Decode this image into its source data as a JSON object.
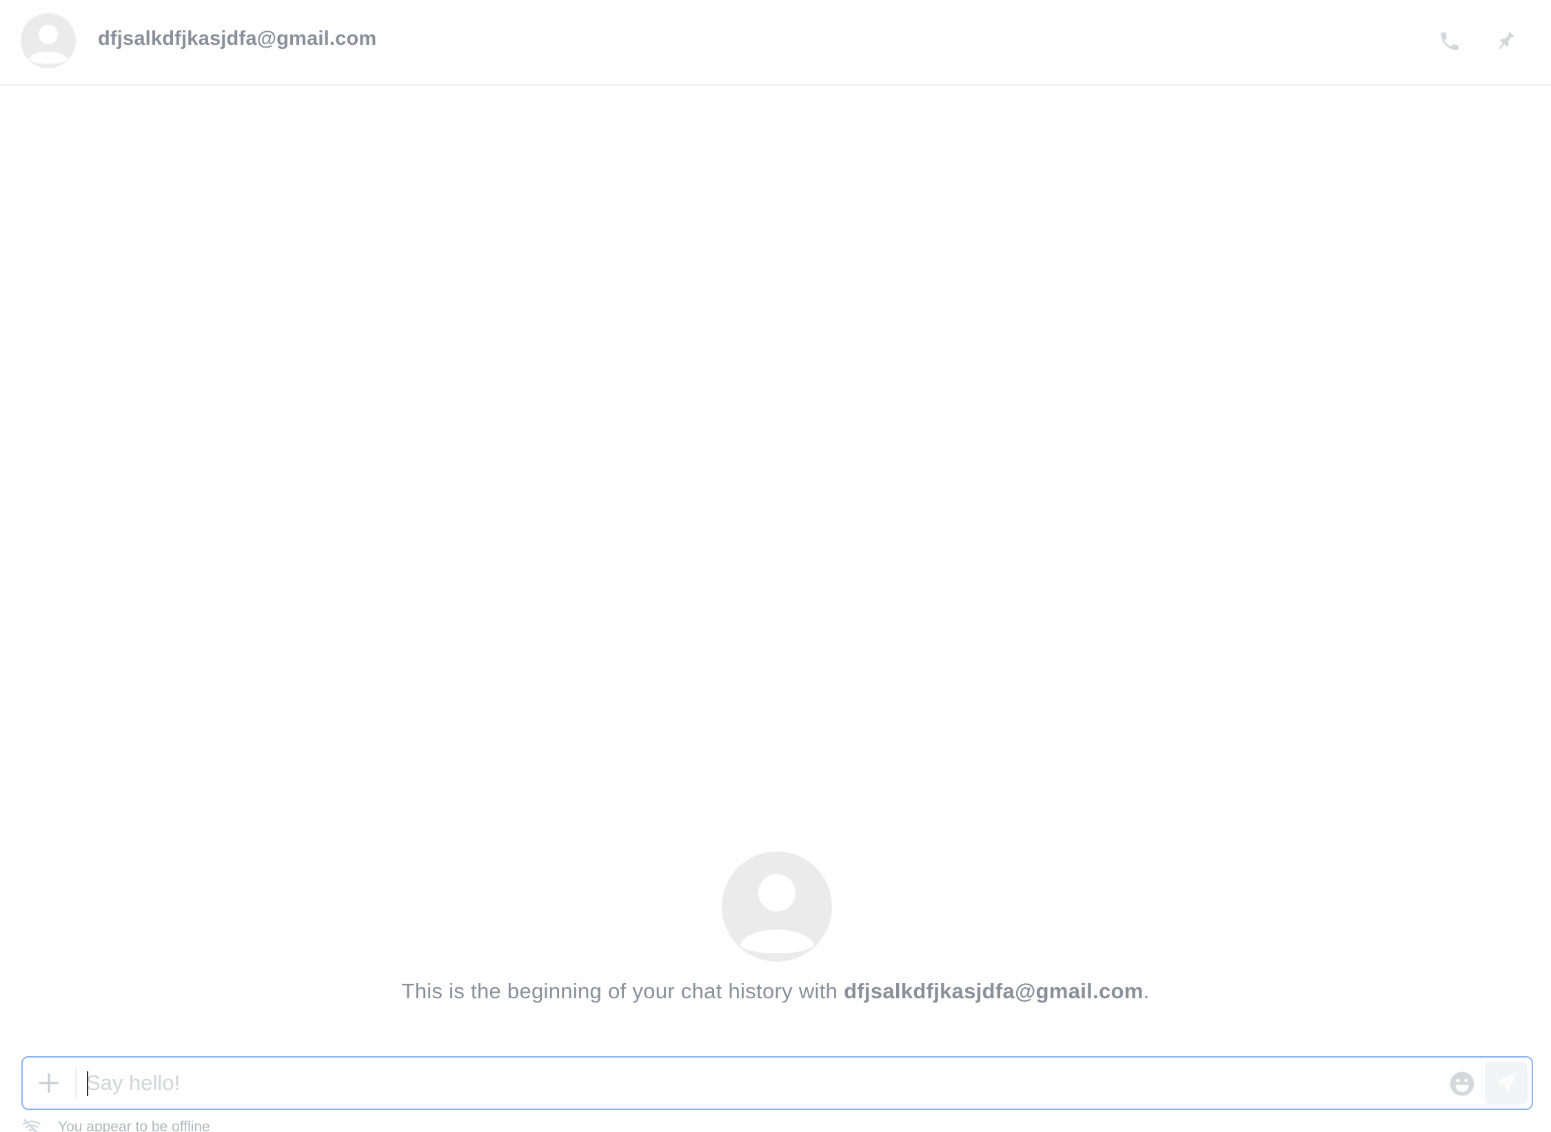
{
  "header": {
    "contact_name": "dfjsalkdfjkasjdfa@gmail.com",
    "phone_icon": "phone-icon",
    "pin_icon": "pin-icon",
    "avatar_icon": "user-avatar-icon"
  },
  "chat": {
    "intro_prefix": "This is the beginning of your chat history with ",
    "intro_name": "dfjsalkdfjkasjdfa@gmail.com",
    "intro_suffix": "."
  },
  "composer": {
    "placeholder": "Say hello!",
    "value": "",
    "add_icon": "plus-icon",
    "emoji_icon": "emoji-icon",
    "send_icon": "send-icon"
  },
  "status": {
    "offline_text": "You appear to be offline",
    "offline_icon": "wifi-off-icon"
  },
  "colors": {
    "text_muted": "#8a909a",
    "avatar_bg": "#ebebeb",
    "input_focus_border": "#8cb4f0",
    "icon_light": "#d5d7db"
  }
}
